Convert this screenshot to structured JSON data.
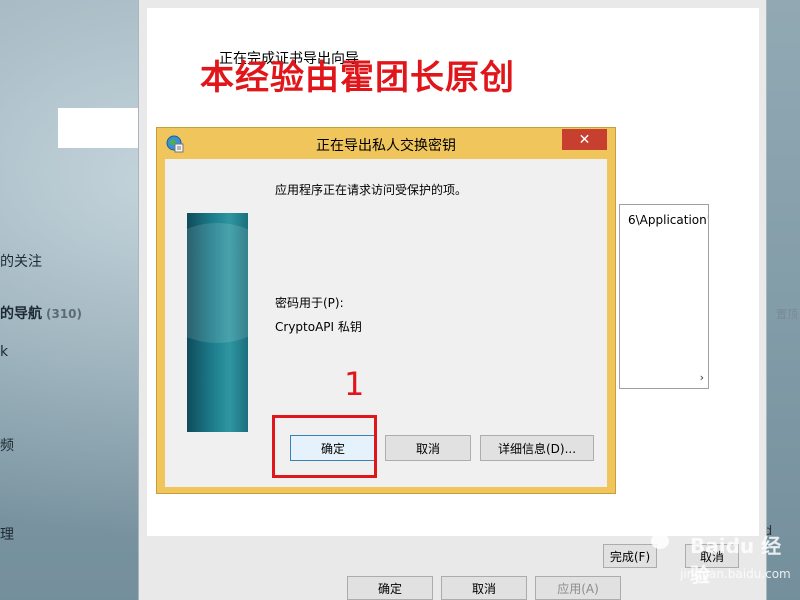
{
  "background": {
    "items": [
      {
        "label": "的关注"
      },
      {
        "label": "的导航",
        "count": "(310)"
      },
      {
        "label": "k"
      },
      {
        "label": "频"
      },
      {
        "label": "理"
      }
    ],
    "right_labels": [
      "置顶",
      "d"
    ]
  },
  "wizard": {
    "title": "正在完成证书导出向导",
    "listbox_text": "6\\Application'",
    "scroll_arrow": "›",
    "finish_label": "完成(F)",
    "cancel_label": "取消",
    "ok_label": "确定",
    "cancel2_label": "取消",
    "apply_label": "应用(A)"
  },
  "watermark": "本经验由霍团长原创",
  "dialog": {
    "title": "正在导出私人交换密钥",
    "close_glyph": "✕",
    "message": "应用程序正在请求访问受保护的项。",
    "password_label": "密码用于(P):",
    "password_value": "CryptoAPI 私钥",
    "ok_label": "确定",
    "cancel_label": "取消",
    "details_label": "详细信息(D)..."
  },
  "annotation": {
    "number": "1",
    "color": "#e0161a"
  },
  "logo": {
    "text": "Baidu 经验",
    "sub": "jingyan.baidu.com"
  }
}
